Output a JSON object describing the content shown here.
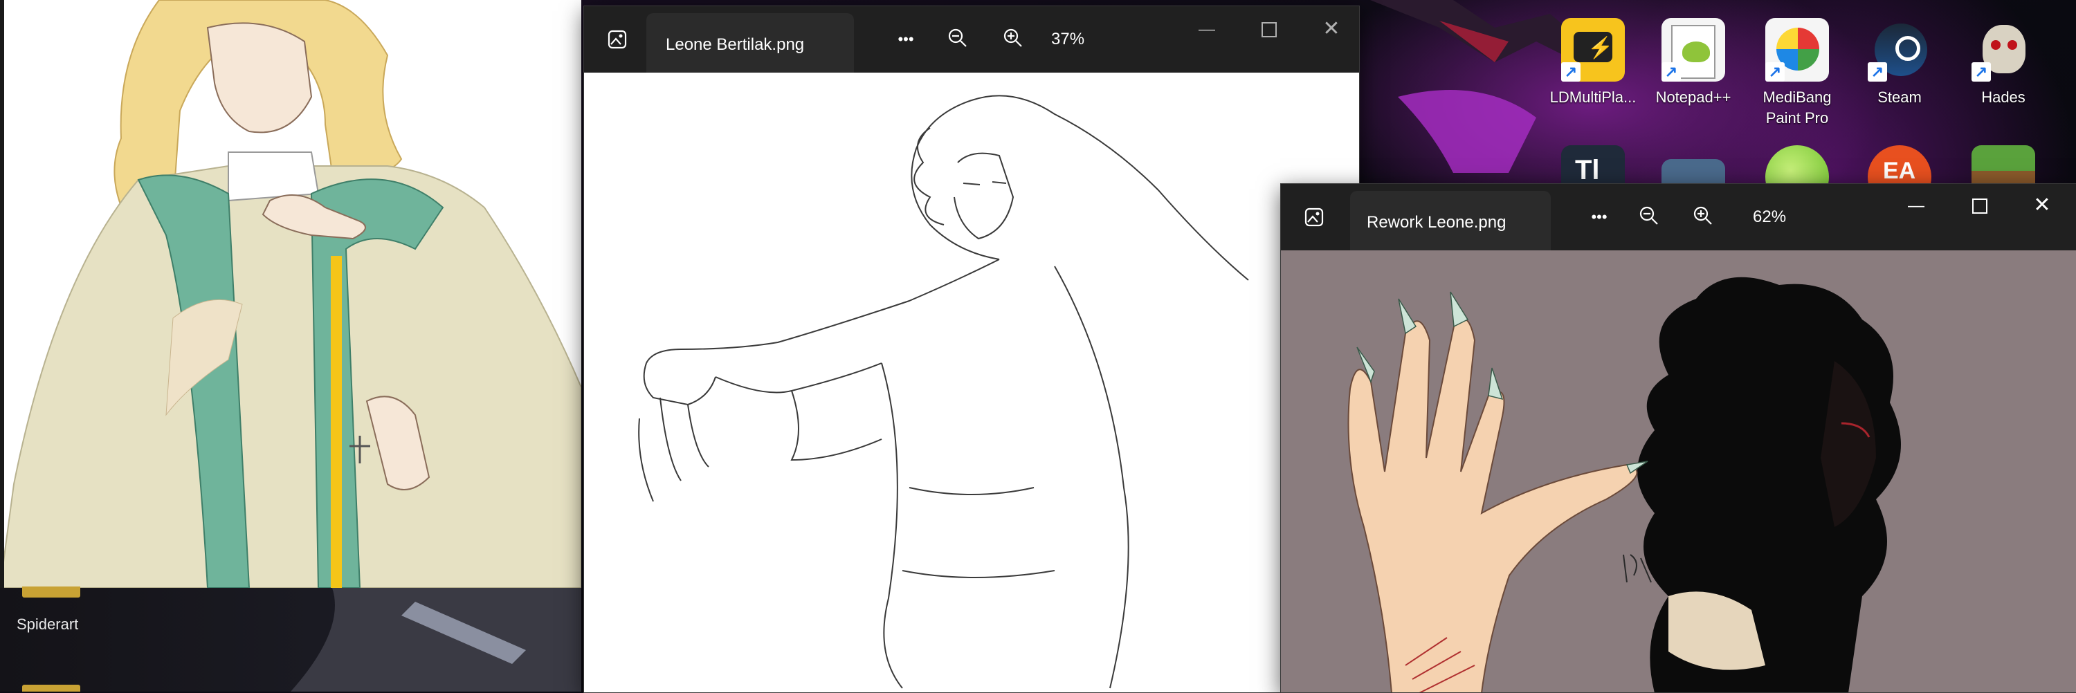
{
  "desktop": {
    "icons_row1": [
      {
        "label": "LDMultiPla...",
        "icon": "ldmultiplayer-icon",
        "color": "#f7c41d"
      },
      {
        "label": "Notepad++",
        "icon": "notepad-plus-plus-icon",
        "color": "#8fc43a"
      },
      {
        "label": "MediBang Paint Pro",
        "icon": "medibang-icon",
        "color": "#f5f5f5"
      },
      {
        "label": "Steam",
        "icon": "steam-icon",
        "color": "#1b2838"
      },
      {
        "label": "Hades",
        "icon": "hades-icon",
        "color": "#8a1a1a"
      }
    ],
    "icons_row2": [
      {
        "icon": "tl-app-icon",
        "glyph": "Tl"
      },
      {
        "icon": "monitor-app-icon"
      },
      {
        "icon": "lime-app-icon"
      },
      {
        "icon": "ea-icon",
        "glyph": "EA"
      },
      {
        "icon": "minecraft-icon"
      }
    ]
  },
  "explorer": {
    "folder_label": "Spiderart"
  },
  "window_leone": {
    "title": "Leone Bertilak.png",
    "more": "•••",
    "zoom": "37%"
  },
  "window_rework": {
    "title": "Rework Leone.png",
    "more": "•••",
    "zoom": "62%"
  },
  "colors": {
    "titlebar": "#202020",
    "tab": "#2b2b2b",
    "rework_canvas": "#8a7c7e",
    "cloak": "#e6e1c3",
    "stole": "#6fb49b",
    "hair_blonde": "#f2d98f"
  }
}
